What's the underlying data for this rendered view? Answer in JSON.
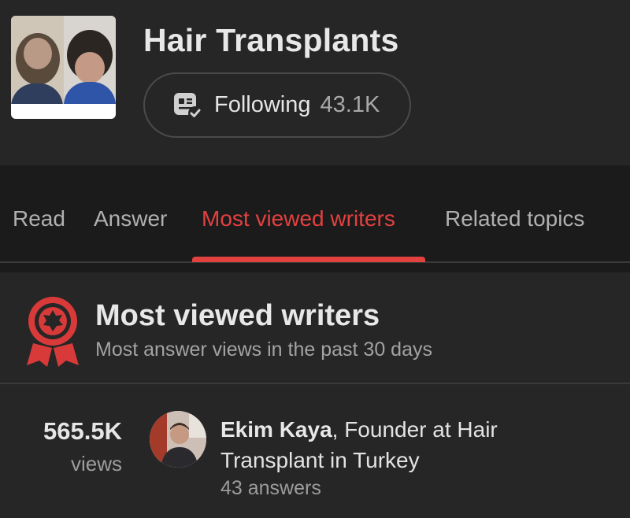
{
  "topic": {
    "title": "Hair Transplants",
    "follow_label": "Following",
    "follow_count": "43.1K",
    "thumbnail_icon": "hair-transplant-before-after-photo"
  },
  "tabs": [
    {
      "label": "Read",
      "active": false
    },
    {
      "label": "Answer",
      "active": false
    },
    {
      "label": "Most viewed writers",
      "active": true
    },
    {
      "label": "Related topics",
      "active": false
    }
  ],
  "section": {
    "title": "Most viewed writers",
    "subtitle": "Most answer views in the past 30 days",
    "icon": "award-ribbon-icon"
  },
  "writers": [
    {
      "views_count": "565.5K",
      "views_label": "views",
      "name": "Ekim Kaya",
      "credential": ", Founder at Hair Transplant in Turkey",
      "answers": "43 answers"
    }
  ],
  "colors": {
    "accent": "#e34040",
    "background": "#262626",
    "tab_background": "#1b1b1b"
  }
}
